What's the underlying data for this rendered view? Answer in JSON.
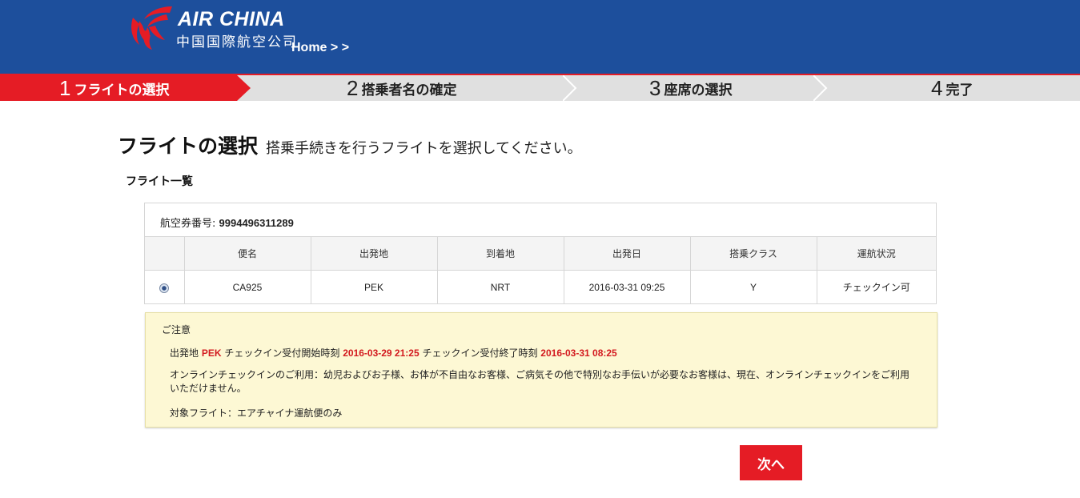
{
  "header": {
    "brand_en": "AIR CHINA",
    "brand_cn": "中国国際航空公司",
    "breadcrumb": "Home > >",
    "colors": {
      "header_bg": "#1d4f9c",
      "accent": "#e51c25"
    }
  },
  "steps": [
    {
      "num": "1",
      "label": "フライトの選択",
      "active": true
    },
    {
      "num": "2",
      "label": "搭乗者名の確定",
      "active": false
    },
    {
      "num": "3",
      "label": "座席の選択",
      "active": false
    },
    {
      "num": "4",
      "label": "完了",
      "active": false
    }
  ],
  "page": {
    "title": "フライトの選択",
    "subtitle": "搭乗手続きを行うフライトを選択してください。",
    "list_title": "フライト一覧"
  },
  "ticket": {
    "label": "航空券番号:",
    "number": "9994496311289"
  },
  "table": {
    "headers": [
      "便名",
      "出発地",
      "到着地",
      "出発日",
      "搭乗クラス",
      "運航状況"
    ],
    "rows": [
      {
        "selected": true,
        "cells": [
          "CA925",
          "PEK",
          "NRT",
          "2016-03-31 09:25",
          "Y",
          "チェックイン可"
        ]
      }
    ]
  },
  "notice": {
    "heading": "ご注意",
    "line1": {
      "prefix": "出発地",
      "airport": "PEK",
      "start_label": "チェックイン受付開始時刻",
      "start_time": "2016-03-29 21:25",
      "end_label": "チェックイン受付終了時刻",
      "end_time": "2016-03-31 08:25"
    },
    "line2": "オンラインチェックインのご利用：幼児およびお子様、お体が不自由なお客様、ご病気その他で特別なお手伝いが必要なお客様は、現在、オンラインチェックインをご利用いただけません。",
    "line3": "対象フライト：エアチャイナ運航便のみ"
  },
  "next_button": "次へ"
}
